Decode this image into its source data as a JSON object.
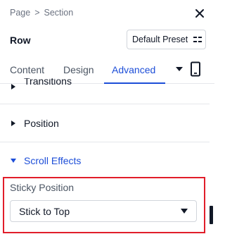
{
  "header": {
    "breadcrumb": [
      "Page",
      "Section"
    ],
    "breadcrumb_separator": ">",
    "close_icon": "close-icon"
  },
  "row": {
    "title": "Row",
    "preset_label": "Default Preset",
    "preset_icon": "preset-menu-icon"
  },
  "tabs": {
    "items": [
      {
        "label": "Content",
        "active": false
      },
      {
        "label": "Design",
        "active": false
      },
      {
        "label": "Advanced",
        "active": true
      }
    ],
    "more_icon": "caret-down-icon",
    "device_icon": "mobile-device-icon"
  },
  "sections": [
    {
      "label": "Transitions",
      "state": "collapsed"
    },
    {
      "label": "Position",
      "state": "collapsed"
    },
    {
      "label": "Scroll Effects",
      "state": "expanded"
    }
  ],
  "sticky": {
    "label": "Sticky Position",
    "value": "Stick to Top"
  },
  "colors": {
    "accent": "#1d4ed8",
    "highlight": "#e11d2a",
    "text": "#111827",
    "muted": "#6b7280"
  }
}
